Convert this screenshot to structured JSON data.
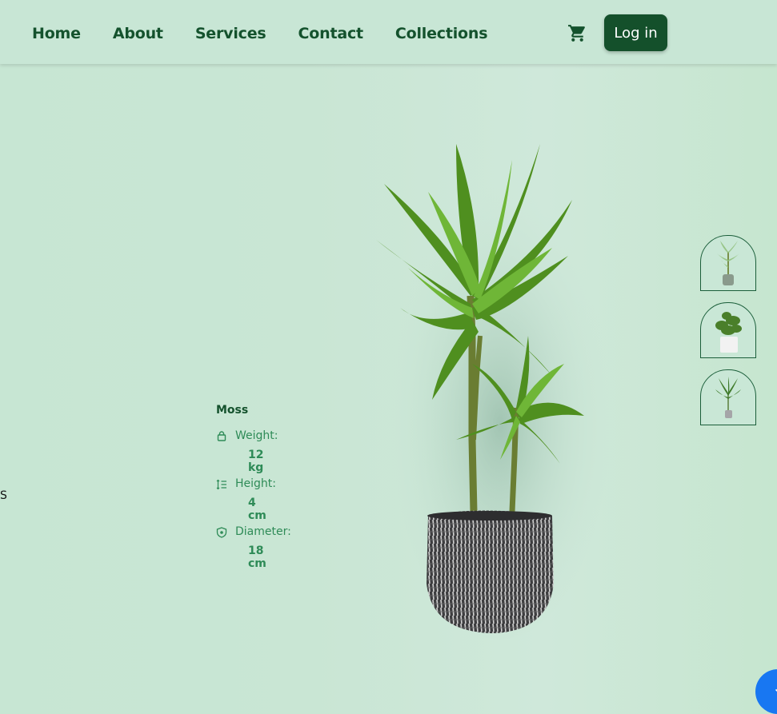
{
  "nav": {
    "links": [
      "Home",
      "About",
      "Services",
      "Contact",
      "Collections"
    ],
    "cart_icon": "cart-icon",
    "login_label": "Log in"
  },
  "page": {
    "stray_letter": "S"
  },
  "product": {
    "name": "Moss",
    "specs": [
      {
        "icon": "weight-icon",
        "label": "Weight:",
        "value": "12 kg"
      },
      {
        "icon": "height-icon",
        "label": "Height:",
        "value": "4 cm"
      },
      {
        "icon": "shield-icon",
        "label": "Diameter:",
        "value": "18 cm"
      }
    ]
  },
  "thumbnails": [
    "dracaena-thumbnail",
    "monstera-thumbnail",
    "palm-thumbnail"
  ],
  "float_button_icon": "arrow-down-icon",
  "colors": {
    "background": "#c8e6d5",
    "primary": "#14502b",
    "accent": "#2e8b57",
    "float_button": "#1877f2"
  }
}
